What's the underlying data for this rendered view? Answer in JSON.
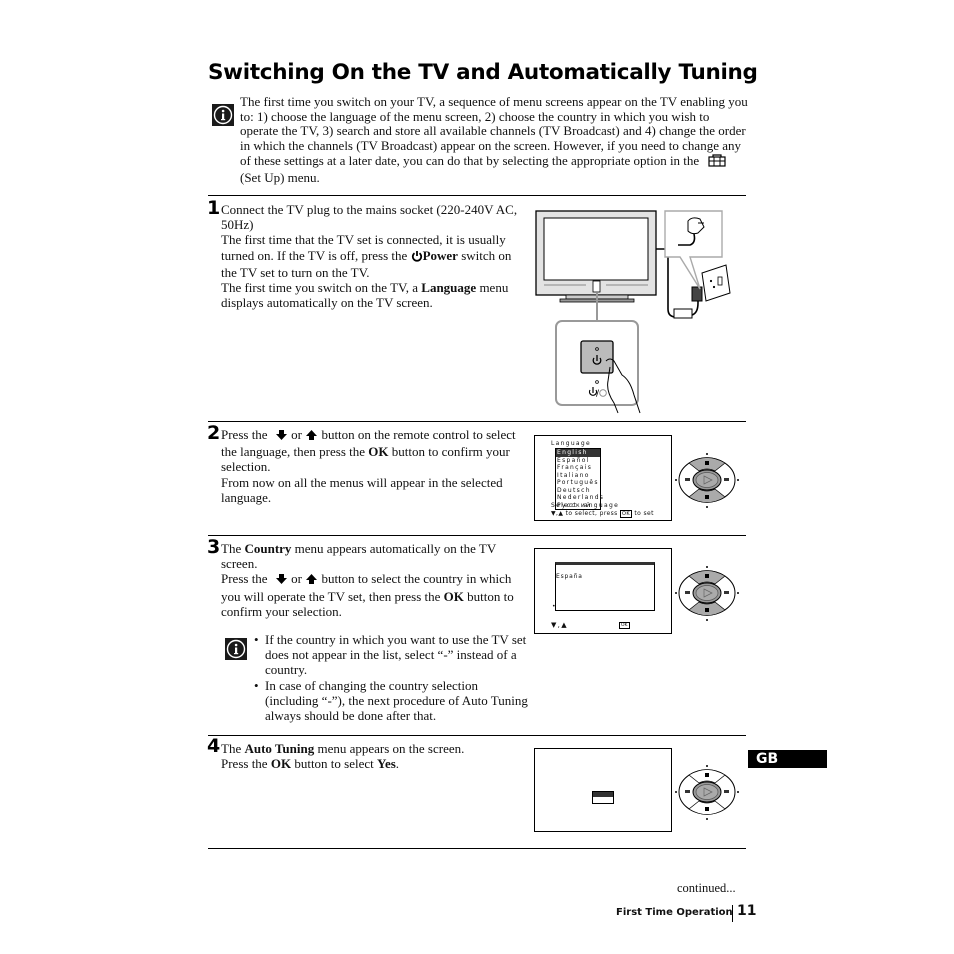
{
  "page": {
    "title": "Switching On the TV and Automatically Tuning",
    "intro": {
      "icon": "info-icon",
      "text_before_icon": "The first time you switch on your TV, a sequence of menu screens appear on the TV enabling you to: 1) choose the language of the menu screen, 2) choose the country in which you wish to operate the TV, 3) search and store all available channels (TV Broadcast) and 4) change the order in which the channels (TV Broadcast) appear on the screen. However, if you need to change any of these settings at a later date, you can do that by selecting the appropriate option in the",
      "setup_icon": "toolbox-icon",
      "text_after_icon": "(Set Up) menu."
    },
    "steps": [
      {
        "number": "1",
        "lines": {
          "l1": "Connect the TV plug to the mains socket (220-240V AC, 50Hz)",
          "l2a": "The first time that the TV set is connected, it is usually turned on. If the TV is off, press the",
          "l2_icon": "power-icon",
          "l2_bold": "Power",
          "l2b": "switch on the TV set to turn on the TV.",
          "l3a": "The first time you switch on the TV, a",
          "l3_bold": "Language",
          "l3b": "menu displays automatically on the TV screen."
        },
        "illustration": {
          "tv": "tv-set-illustration",
          "plug": "mains-plug-illustration",
          "socket": "wall-socket-illustration",
          "power_panel": "power-button-closeup",
          "power_label": "⏻/⊘"
        }
      },
      {
        "number": "2",
        "lines": {
          "a": "Press the",
          "down_icon": "down-arrow-icon",
          "or": "or",
          "up_icon": "up-arrow-icon",
          "b": "button on the remote control to select the language, then press the",
          "ok": "OK",
          "c": "button to confirm your selection.",
          "d": "From now on all the menus will appear in the selected language."
        },
        "screen": {
          "heading": "Language",
          "items": [
            "English",
            "Español",
            "Français",
            "Italiano",
            "Português",
            "Deutsch",
            "Nederlands",
            "Русский"
          ],
          "selected_index": 0,
          "footer1": "Select  anguage",
          "footer2_a": "▼,▲ to select, press",
          "footer2_ok": "OK",
          "footer2_b": "to set"
        }
      },
      {
        "number": "3",
        "lines": {
          "a": "The",
          "country": "Country",
          "b": "menu appears automatically on the TV screen.",
          "c": "Press the",
          "or": "or",
          "d": "button to select the country in which you will operate the TV set, then press the",
          "ok": "OK",
          "e": "button to confirm your selection."
        },
        "screen": {
          "selected_country": "España",
          "footer_left": "▼,▲",
          "footer_ok": "OK"
        },
        "notes": [
          "If the country in which you want to use the TV set does not appear in the list, select “-” instead of a country.",
          "In case of changing the country selection (including “-”), the next procedure of Auto Tuning always should be done after that."
        ]
      },
      {
        "number": "4",
        "lines": {
          "a": "The",
          "auto": "Auto Tuning",
          "b": "menu appears on the screen.",
          "c": "Press the",
          "ok": "OK",
          "d": "button to select",
          "yes": "Yes",
          "period": "."
        }
      }
    ],
    "remote_pad": "remote-navigation-pad",
    "language_tab": "GB",
    "continued": "continued...",
    "footer": {
      "section": "First Time Operation",
      "page_number": "11"
    }
  }
}
